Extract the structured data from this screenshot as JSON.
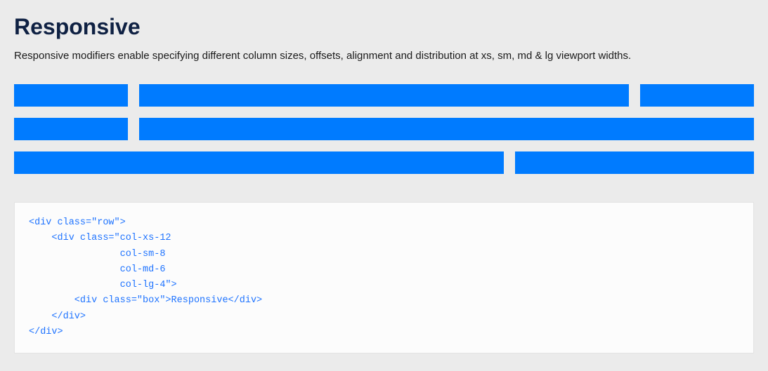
{
  "heading": "Responsive",
  "description": "Responsive modifiers enable specifying different column sizes, offsets, alignment and distribution at xs, sm, md & lg viewport widths.",
  "code": "<div class=\"row\">\n    <div class=\"col-xs-12\n                col-sm-8\n                col-md-6\n                col-lg-4\">\n        <div class=\"box\">Responsive</div>\n    </div>\n</div>",
  "demo_rows": [
    {
      "cols": [
        "c2",
        "c8",
        "c2"
      ]
    },
    {
      "cols": [
        "c2",
        "c10"
      ]
    },
    {
      "cols": [
        "c8",
        "c4"
      ]
    }
  ],
  "box_color": "#007bff"
}
